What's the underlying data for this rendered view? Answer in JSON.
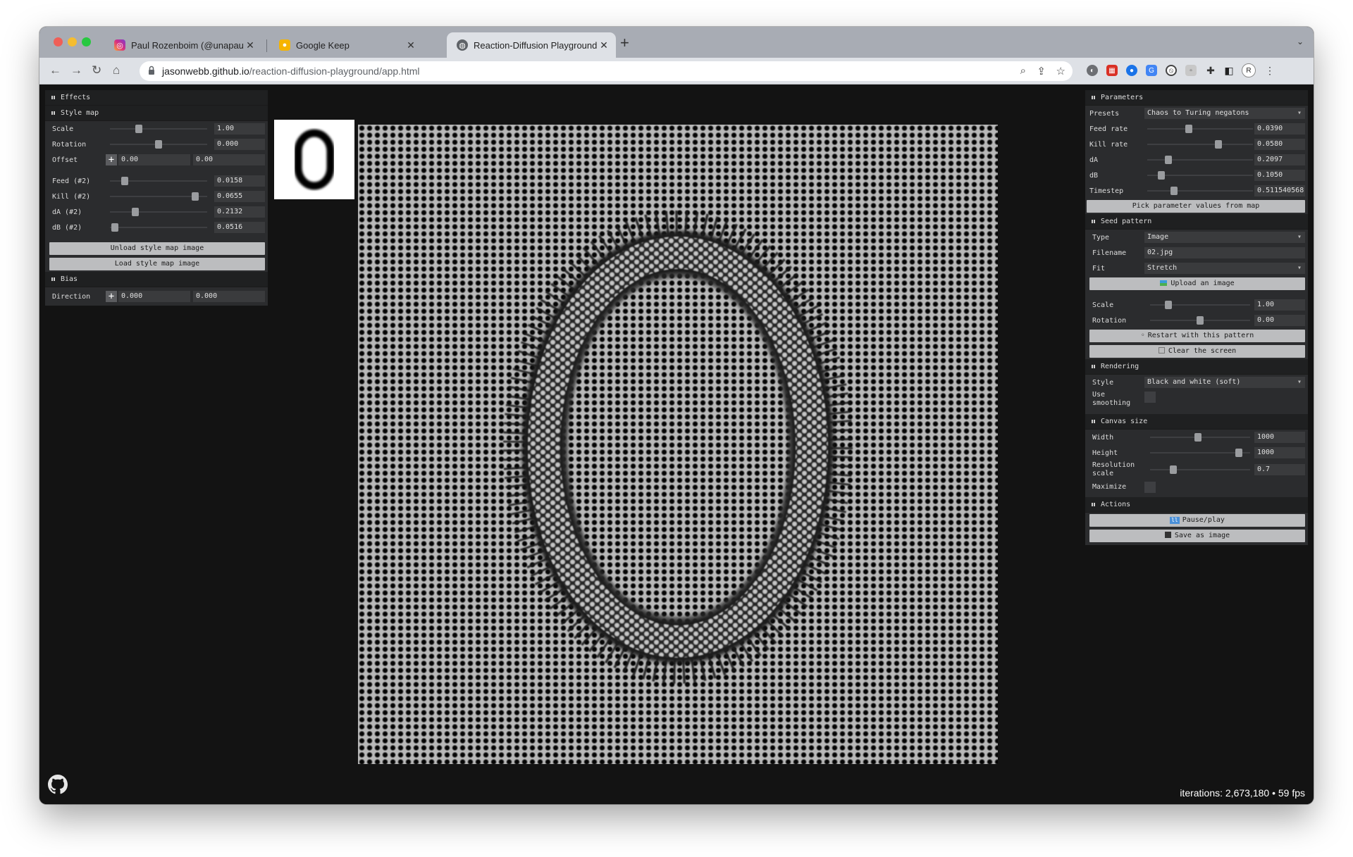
{
  "browser": {
    "tabs": [
      {
        "title": "Paul Rozenboim (@unapaulogetic)",
        "icon": "instagram-icon"
      },
      {
        "title": "Google Keep",
        "icon": "google-keep-icon"
      },
      {
        "title": "Reaction-Diffusion Playground",
        "icon": "globe-icon"
      }
    ],
    "url_host": "jasonwebb.github.io",
    "url_path": "/reaction-diffusion-playground/app.html"
  },
  "left_panel": {
    "effects_title": "Effects",
    "style_map_title": "Style map",
    "scale_label": "Scale",
    "scale_value": "1.00",
    "rotation_label": "Rotation",
    "rotation_value": "0.000",
    "offset_label": "Offset",
    "offset_x": "0.00",
    "offset_y": "0.00",
    "feed2_label": "Feed (#2)",
    "feed2_value": "0.0158",
    "kill2_label": "Kill (#2)",
    "kill2_value": "0.0655",
    "da2_label": "dA (#2)",
    "da2_value": "0.2132",
    "db2_label": "dB (#2)",
    "db2_value": "0.0516",
    "unload_button": "Unload style map image",
    "load_button": "Load style map image",
    "bias_title": "Bias",
    "direction_label": "Direction",
    "direction_x": "0.000",
    "direction_y": "0.000"
  },
  "right_panel": {
    "parameters_title": "Parameters",
    "presets_label": "Presets",
    "presets_value": "Chaos to Turing negatons",
    "feed_label": "Feed rate",
    "feed_value": "0.0390",
    "kill_label": "Kill rate",
    "kill_value": "0.0580",
    "da_label": "dA",
    "da_value": "0.2097",
    "db_label": "dB",
    "db_value": "0.1050",
    "timestep_label": "Timestep",
    "timestep_value": "0.511540568",
    "pick_button": "Pick parameter values from map",
    "seed_title": "Seed pattern",
    "type_label": "Type",
    "type_value": "Image",
    "filename_label": "Filename",
    "filename_value": "02.jpg",
    "fit_label": "Fit",
    "fit_value": "Stretch",
    "upload_button": "Upload an image",
    "seed_scale_label": "Scale",
    "seed_scale_value": "1.00",
    "seed_rotation_label": "Rotation",
    "seed_rotation_value": "0.00",
    "restart_button": "Restart with this pattern",
    "clear_button": "Clear the screen",
    "rendering_title": "Rendering",
    "style_label": "Style",
    "style_value": "Black and white (soft)",
    "smoothing_label_1": "Use",
    "smoothing_label_2": "smoothing",
    "canvas_title": "Canvas size",
    "width_label": "Width",
    "width_value": "1000",
    "height_label": "Height",
    "height_value": "1000",
    "resolution_label_1": "Resolution",
    "resolution_label_2": "scale",
    "resolution_value": "0.7",
    "maximize_label": "Maximize",
    "actions_title": "Actions",
    "pause_button": "Pause/play",
    "save_button": "Save as image"
  },
  "seed_thumbnail_char": "0",
  "status": "iterations: 2,673,180 • 59 fps",
  "sliders": {
    "left_scale": 0.3,
    "left_rotation": 0.5,
    "feed2": 0.15,
    "kill2": 0.88,
    "da2": 0.26,
    "db2": 0.05,
    "feed": 0.39,
    "kill": 0.67,
    "da": 0.2,
    "db": 0.13,
    "timestep": 0.25,
    "seed_scale": 0.18,
    "seed_rotation": 0.5,
    "width": 0.48,
    "height": 0.89,
    "resolution": 0.23
  },
  "colors": {
    "accent_knob": "#9a9c9f",
    "button": "#bcbdbf",
    "panel": "#2b2c2e"
  }
}
